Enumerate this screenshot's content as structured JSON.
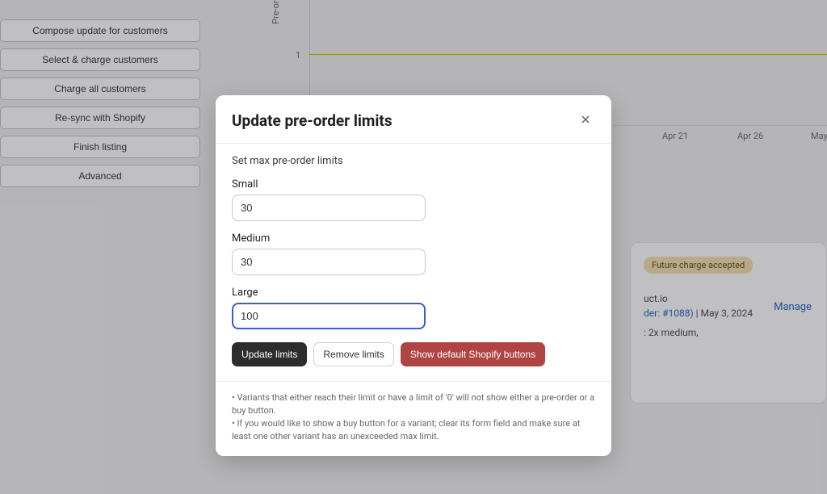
{
  "sidebar": {
    "buttons": [
      "Compose update for customers",
      "Select & charge customers",
      "Charge all customers",
      "Re-sync with Shopify",
      "Finish listing",
      "Advanced"
    ]
  },
  "chart": {
    "y_label": "Pre-orders",
    "y_tick": "1",
    "x_ticks": {
      "apr21": "Apr 21",
      "apr26": "Apr 26",
      "may": "May"
    }
  },
  "card": {
    "badge": "Future charge accepted",
    "domain_fragment": "uct.io",
    "order_fragment": "der: #1088)",
    "sep": " | ",
    "date": "May 3, 2024",
    "qty_fragment": ": 2x medium,",
    "manage": "Manage"
  },
  "modal": {
    "title": "Update pre-order limits",
    "section": "Set max pre-order limits",
    "fields": {
      "small": {
        "label": "Small",
        "value": "30"
      },
      "medium": {
        "label": "Medium",
        "value": "30"
      },
      "large": {
        "label": "Large",
        "value": "100"
      }
    },
    "buttons": {
      "update": "Update limits",
      "remove": "Remove limits",
      "show_default": "Show default Shopify buttons"
    },
    "notes": {
      "n1": "• Variants that either reach their limit or have a limit of '0' will not show either a pre-order or a buy button.",
      "n2": "• If you would like to show a buy button for a variant; clear its form field and make sure at least one other variant has an unexceeded max limit."
    }
  }
}
